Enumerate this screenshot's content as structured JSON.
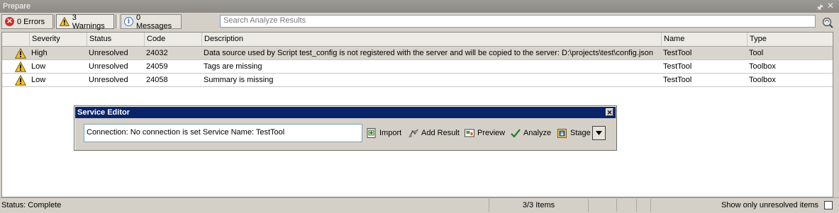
{
  "panel": {
    "title": "Prepare",
    "pin_icon": "pin-icon",
    "close_icon": "close-icon"
  },
  "toolbar": {
    "errors_label": "0 Errors",
    "warnings_label": "3 Warnings",
    "messages_label": "0 Messages",
    "search_placeholder": "Search Analyze Results"
  },
  "grid": {
    "columns": [
      "Severity",
      "Status",
      "Code",
      "Description",
      "Name",
      "Type"
    ],
    "rows": [
      {
        "severity": "High",
        "status": "Unresolved",
        "code": "24032",
        "description": "Data source used by Script test_config is not registered with the server and will be copied to the server: D:\\projects\\test\\config.json",
        "name": "TestTool",
        "type": "Tool"
      },
      {
        "severity": "Low",
        "status": "Unresolved",
        "code": "24059",
        "description": "Tags are missing",
        "name": "TestTool",
        "type": "Toolbox"
      },
      {
        "severity": "Low",
        "status": "Unresolved",
        "code": "24058",
        "description": "Summary is missing",
        "name": "TestTool",
        "type": "Toolbox"
      }
    ]
  },
  "service_editor": {
    "title": "Service Editor",
    "connection_text": "Connection: No connection is set   Service Name: TestTool",
    "import_label": "Import",
    "add_result_label": "Add Result",
    "preview_label": "Preview",
    "analyze_label": "Analyze",
    "stage_label": "Stage"
  },
  "status_bar": {
    "status": "Status: Complete",
    "items": "3/3 Items",
    "unresolved_label": "Show only unresolved items",
    "unresolved_checked": false
  },
  "colors": {
    "error": "#c8312b",
    "warning": "#f2c22b",
    "dialog_title": "#0a246a",
    "accent": "#3b6ec8"
  }
}
